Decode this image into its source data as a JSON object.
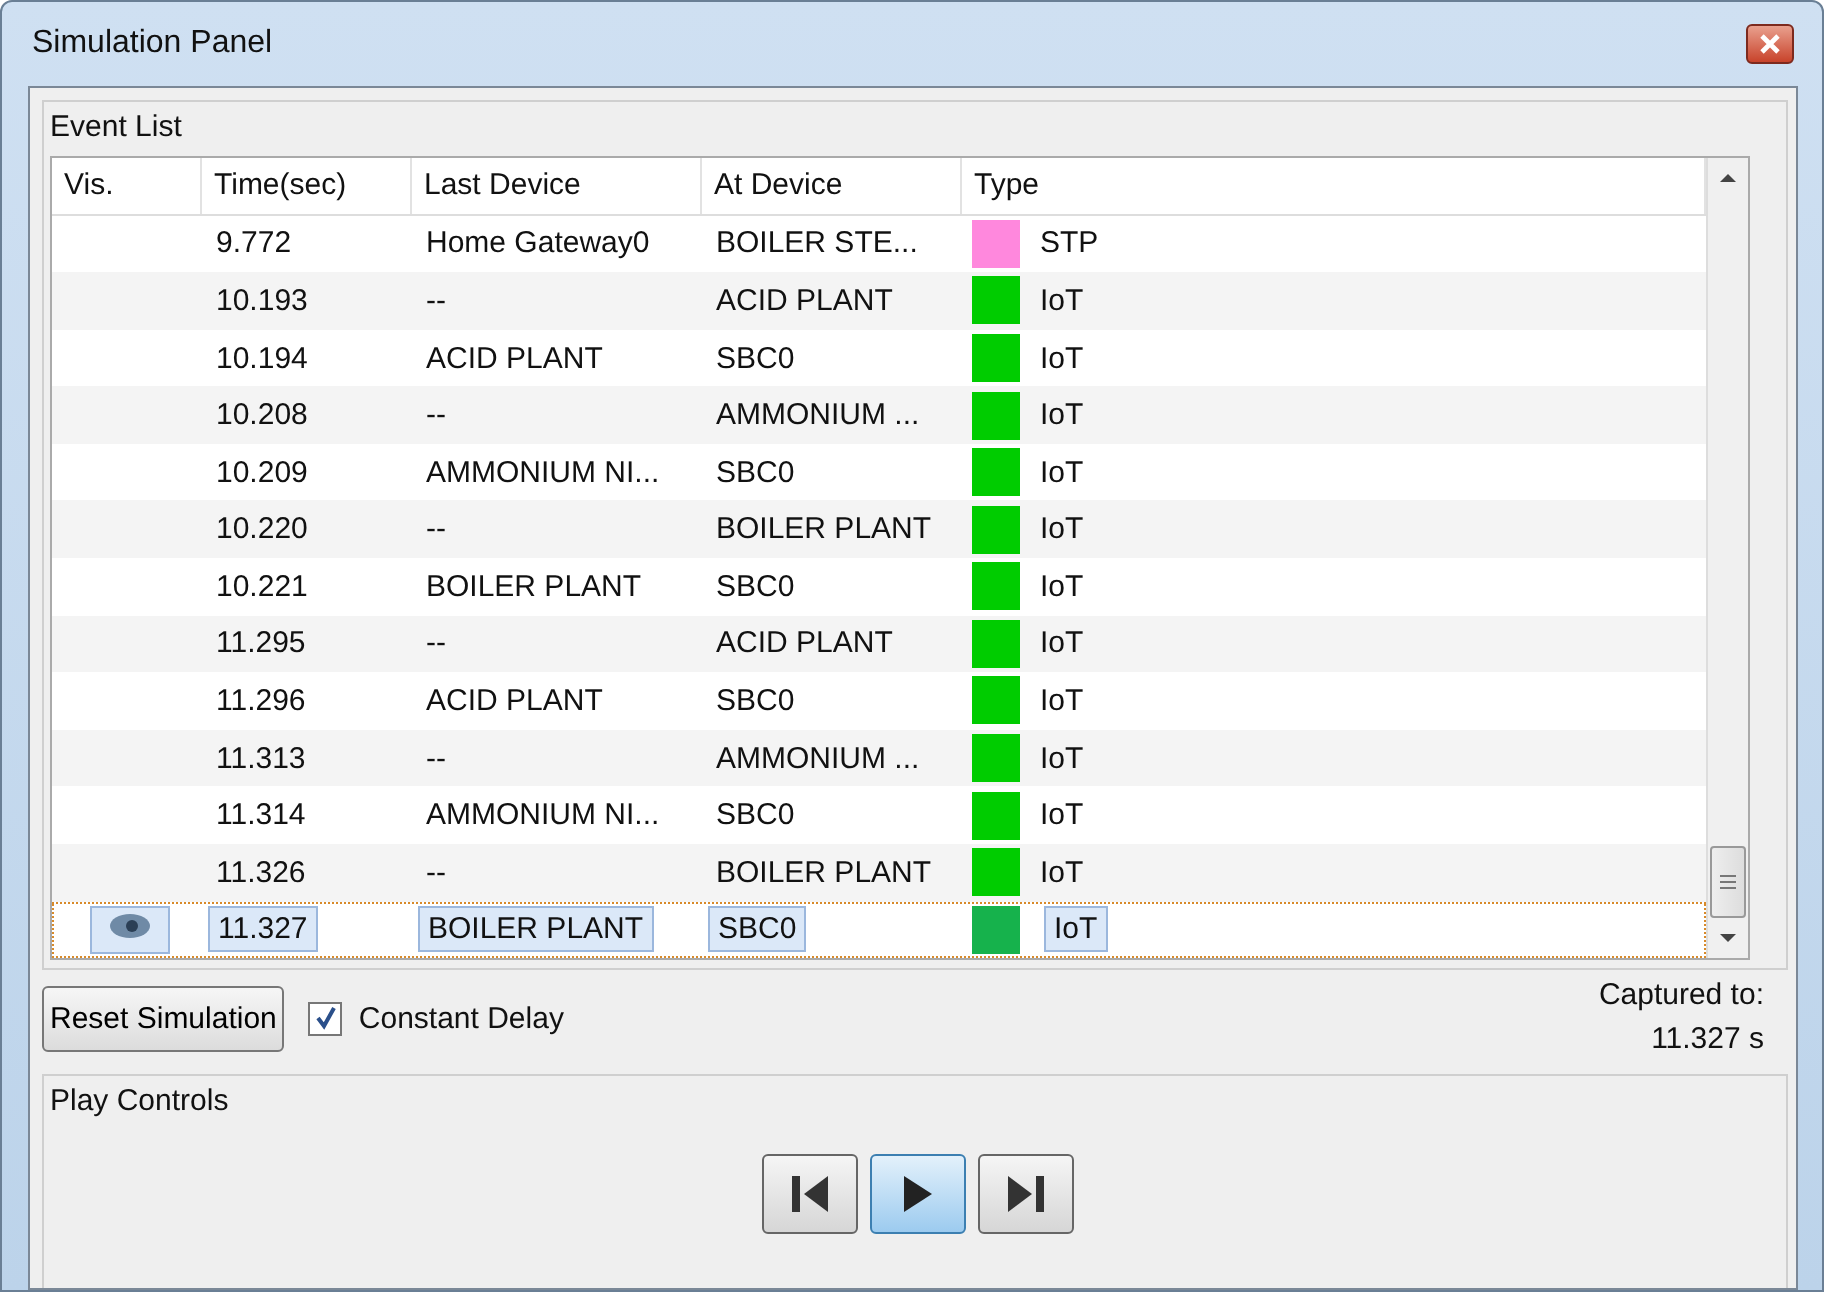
{
  "window": {
    "title": "Simulation Panel"
  },
  "event_list": {
    "title": "Event List",
    "columns": [
      "Vis.",
      "Time(sec)",
      "Last Device",
      "At Device",
      "Type"
    ],
    "rows": [
      {
        "time": "9.772",
        "last_device": "Home Gateway0",
        "at_device": "BOILER STE...",
        "type": "STP",
        "color": "#ff88dd",
        "visible": false,
        "selected": false
      },
      {
        "time": "10.193",
        "last_device": "--",
        "at_device": "ACID PLANT",
        "type": "IoT",
        "color": "#00cc00",
        "visible": false,
        "selected": false
      },
      {
        "time": "10.194",
        "last_device": "ACID PLANT",
        "at_device": "SBC0",
        "type": "IoT",
        "color": "#00cc00",
        "visible": false,
        "selected": false
      },
      {
        "time": "10.208",
        "last_device": "--",
        "at_device": "AMMONIUM ...",
        "type": "IoT",
        "color": "#00cc00",
        "visible": false,
        "selected": false
      },
      {
        "time": "10.209",
        "last_device": "AMMONIUM NI...",
        "at_device": "SBC0",
        "type": "IoT",
        "color": "#00cc00",
        "visible": false,
        "selected": false
      },
      {
        "time": "10.220",
        "last_device": "--",
        "at_device": "BOILER PLANT",
        "type": "IoT",
        "color": "#00cc00",
        "visible": false,
        "selected": false
      },
      {
        "time": "10.221",
        "last_device": "BOILER PLANT",
        "at_device": "SBC0",
        "type": "IoT",
        "color": "#00cc00",
        "visible": false,
        "selected": false
      },
      {
        "time": "11.295",
        "last_device": "--",
        "at_device": "ACID PLANT",
        "type": "IoT",
        "color": "#00cc00",
        "visible": false,
        "selected": false
      },
      {
        "time": "11.296",
        "last_device": "ACID PLANT",
        "at_device": "SBC0",
        "type": "IoT",
        "color": "#00cc00",
        "visible": false,
        "selected": false
      },
      {
        "time": "11.313",
        "last_device": "--",
        "at_device": "AMMONIUM ...",
        "type": "IoT",
        "color": "#00cc00",
        "visible": false,
        "selected": false
      },
      {
        "time": "11.314",
        "last_device": "AMMONIUM NI...",
        "at_device": "SBC0",
        "type": "IoT",
        "color": "#00cc00",
        "visible": false,
        "selected": false
      },
      {
        "time": "11.326",
        "last_device": "--",
        "at_device": "BOILER PLANT",
        "type": "IoT",
        "color": "#00cc00",
        "visible": false,
        "selected": false
      },
      {
        "time": "11.327",
        "last_device": "BOILER PLANT",
        "at_device": "SBC0",
        "type": "IoT",
        "color": "#16b24c",
        "visible": true,
        "selected": true
      }
    ]
  },
  "reset_button": "Reset Simulation",
  "constant_delay": {
    "label": "Constant Delay",
    "checked": true
  },
  "captured": {
    "label": "Captured to:",
    "value": "11.327 s"
  },
  "play_controls": {
    "title": "Play Controls",
    "buttons": [
      {
        "kind": "back",
        "selected": false
      },
      {
        "kind": "play",
        "selected": true
      },
      {
        "kind": "forward",
        "selected": false
      }
    ]
  }
}
